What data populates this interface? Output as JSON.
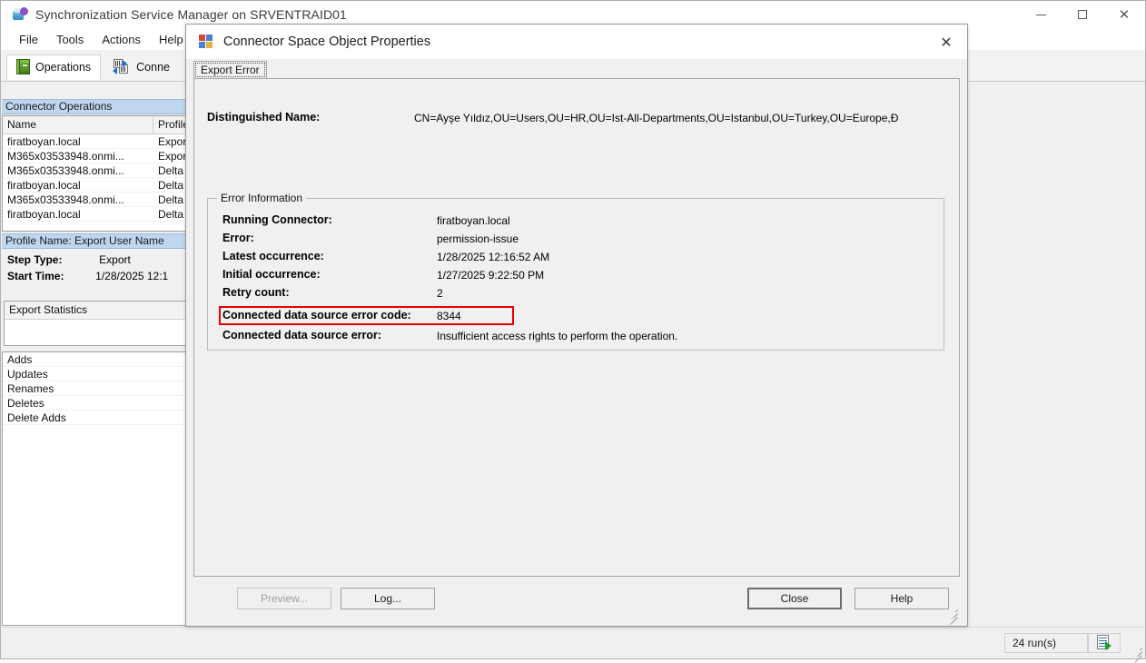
{
  "app": {
    "title": "Synchronization Service Manager on SRVENTRAID01",
    "icon": "sync-service-icon",
    "window_controls": [
      {
        "name": "minimize-button",
        "glyph": "minimize"
      },
      {
        "name": "maximize-button",
        "glyph": "maximize"
      },
      {
        "name": "close-button",
        "glyph": "close"
      }
    ],
    "menu": [
      "File",
      "Tools",
      "Actions",
      "Help"
    ],
    "toolbar_tabs": [
      {
        "label": "Operations",
        "icon": "operations-book-icon",
        "active": true
      },
      {
        "label": "Conne",
        "icon": "connectors-icon",
        "active": false
      }
    ]
  },
  "connector_operations": {
    "header": "Connector Operations",
    "columns": [
      "Name",
      "Profile"
    ],
    "rows": [
      {
        "name": "firatboyan.local",
        "profile": "Export"
      },
      {
        "name": "M365x03533948.onmi...",
        "profile": "Export"
      },
      {
        "name": "M365x03533948.onmi...",
        "profile": "Delta"
      },
      {
        "name": "firatboyan.local",
        "profile": "Delta"
      },
      {
        "name": "M365x03533948.onmi...",
        "profile": "Delta"
      },
      {
        "name": "firatboyan.local",
        "profile": "Delta"
      }
    ]
  },
  "profile_panel": {
    "header": "Profile Name: Export  User Name",
    "step_type_label": "Step Type:",
    "step_type_value": "Export",
    "start_time_label": "Start Time:",
    "start_time_value": "1/28/2025 12:1"
  },
  "export_statistics": {
    "header": "Export Statistics",
    "rows": [
      "Adds",
      "Updates",
      "Renames",
      "Deletes",
      "Delete Adds"
    ]
  },
  "status_bar": {
    "run_count": "24 run(s)",
    "run_icon": "run-profile-icon"
  },
  "dialog": {
    "title": "Connector Space Object Properties",
    "icon": "properties-window-icon",
    "close_glyph": "✕",
    "tabs": [
      {
        "label": "Export Error",
        "active": true
      }
    ],
    "distinguished_name_label": "Distinguished Name:",
    "distinguished_name_value": "CN=Ayşe Yıldız,OU=Users,OU=HR,OU=Ist-All-Departments,OU=Istanbul,OU=Turkey,OU=Europe,Đ",
    "error_group_title": "Error Information",
    "error_rows": [
      {
        "key": "Running Connector:",
        "value": "firatboyan.local",
        "highlighted": false
      },
      {
        "key": "Error:",
        "value": "permission-issue",
        "highlighted": false
      },
      {
        "key": "Latest occurrence:",
        "value": "1/28/2025 12:16:52 AM",
        "highlighted": false
      },
      {
        "key": "Initial occurrence:",
        "value": "1/27/2025 9:22:50 PM",
        "highlighted": false
      },
      {
        "key": "Retry count:",
        "value": "2",
        "highlighted": false
      },
      {
        "key": "Connected data source error code:",
        "value": "8344",
        "highlighted": true
      },
      {
        "key": "Connected data source error:",
        "value": "Insufficient access rights to perform the operation.",
        "highlighted": false
      }
    ],
    "highlight_color": "#e60000",
    "buttons": [
      {
        "label": "Preview...",
        "name": "preview-button",
        "state": "disabled"
      },
      {
        "label": "Log...",
        "name": "log-button",
        "state": "enabled"
      },
      {
        "label": "Close",
        "name": "close-button",
        "state": "default"
      },
      {
        "label": "Help",
        "name": "help-button",
        "state": "enabled"
      }
    ]
  }
}
